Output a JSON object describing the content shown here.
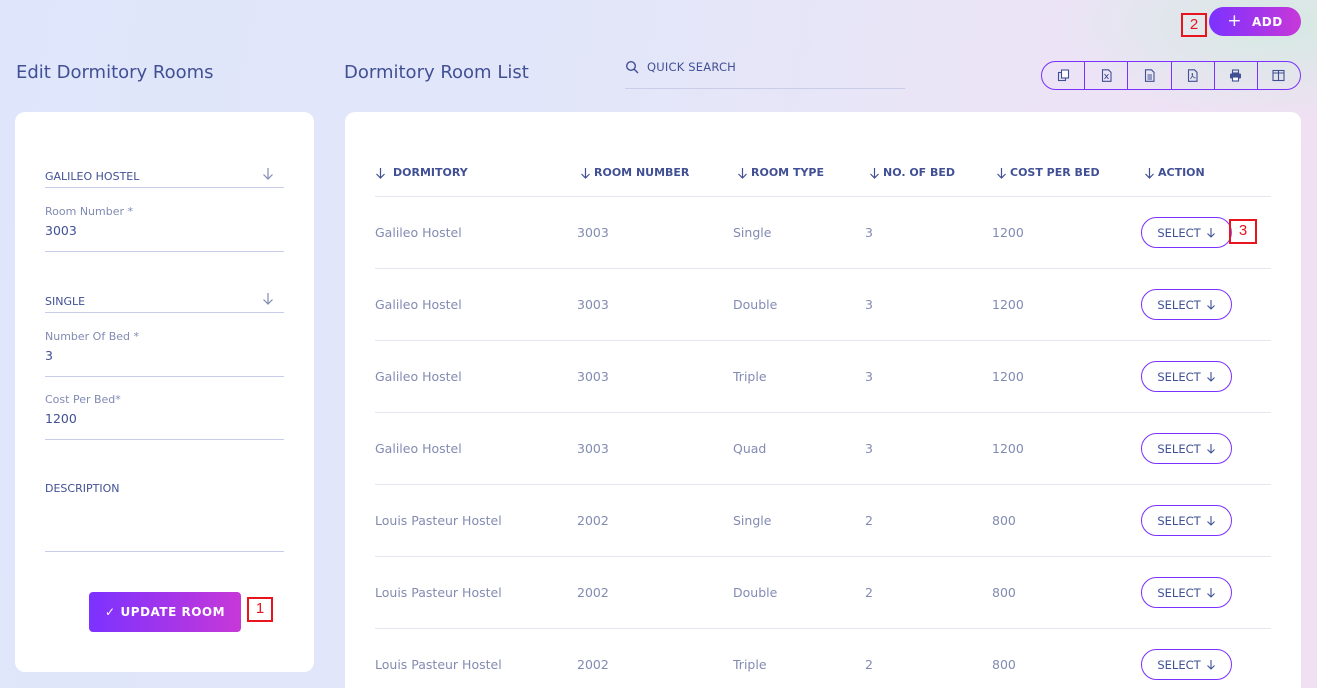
{
  "header": {
    "add_label": "ADD",
    "add_icon": "plus-icon"
  },
  "markers": {
    "m1": "1",
    "m2": "2",
    "m3": "3"
  },
  "form": {
    "title": "Edit Dormitory Rooms",
    "dormitory": "GALILEO HOSTEL",
    "room_number_label": "Room Number *",
    "room_number": "3003",
    "room_type": "SINGLE",
    "number_of_bed_label": "Number Of Bed *",
    "number_of_bed": "3",
    "cost_per_bed_label": "Cost Per Bed*",
    "cost_per_bed": "1200",
    "description_label": "DESCRIPTION",
    "update_label": "UPDATE ROOM"
  },
  "list": {
    "title": "Dormitory Room List",
    "search_placeholder": "QUICK SEARCH",
    "export_icons": [
      "copy-icon",
      "excel-icon",
      "csv-icon",
      "pdf-icon",
      "print-icon",
      "columns-icon"
    ],
    "columns": [
      "DORMITORY",
      "ROOM NUMBER",
      "ROOM TYPE",
      "NO. OF BED",
      "COST PER BED",
      "ACTION"
    ],
    "select_label": "SELECT",
    "rows": [
      {
        "dormitory": "Galileo Hostel",
        "room_number": "3003",
        "room_type": "Single",
        "beds": "3",
        "cost": "1200"
      },
      {
        "dormitory": "Galileo Hostel",
        "room_number": "3003",
        "room_type": "Double",
        "beds": "3",
        "cost": "1200"
      },
      {
        "dormitory": "Galileo Hostel",
        "room_number": "3003",
        "room_type": "Triple",
        "beds": "3",
        "cost": "1200"
      },
      {
        "dormitory": "Galileo Hostel",
        "room_number": "3003",
        "room_type": "Quad",
        "beds": "3",
        "cost": "1200"
      },
      {
        "dormitory": "Louis Pasteur Hostel",
        "room_number": "2002",
        "room_type": "Single",
        "beds": "2",
        "cost": "800"
      },
      {
        "dormitory": "Louis Pasteur Hostel",
        "room_number": "2002",
        "room_type": "Double",
        "beds": "2",
        "cost": "800"
      },
      {
        "dormitory": "Louis Pasteur Hostel",
        "room_number": "2002",
        "room_type": "Triple",
        "beds": "2",
        "cost": "800"
      }
    ]
  }
}
